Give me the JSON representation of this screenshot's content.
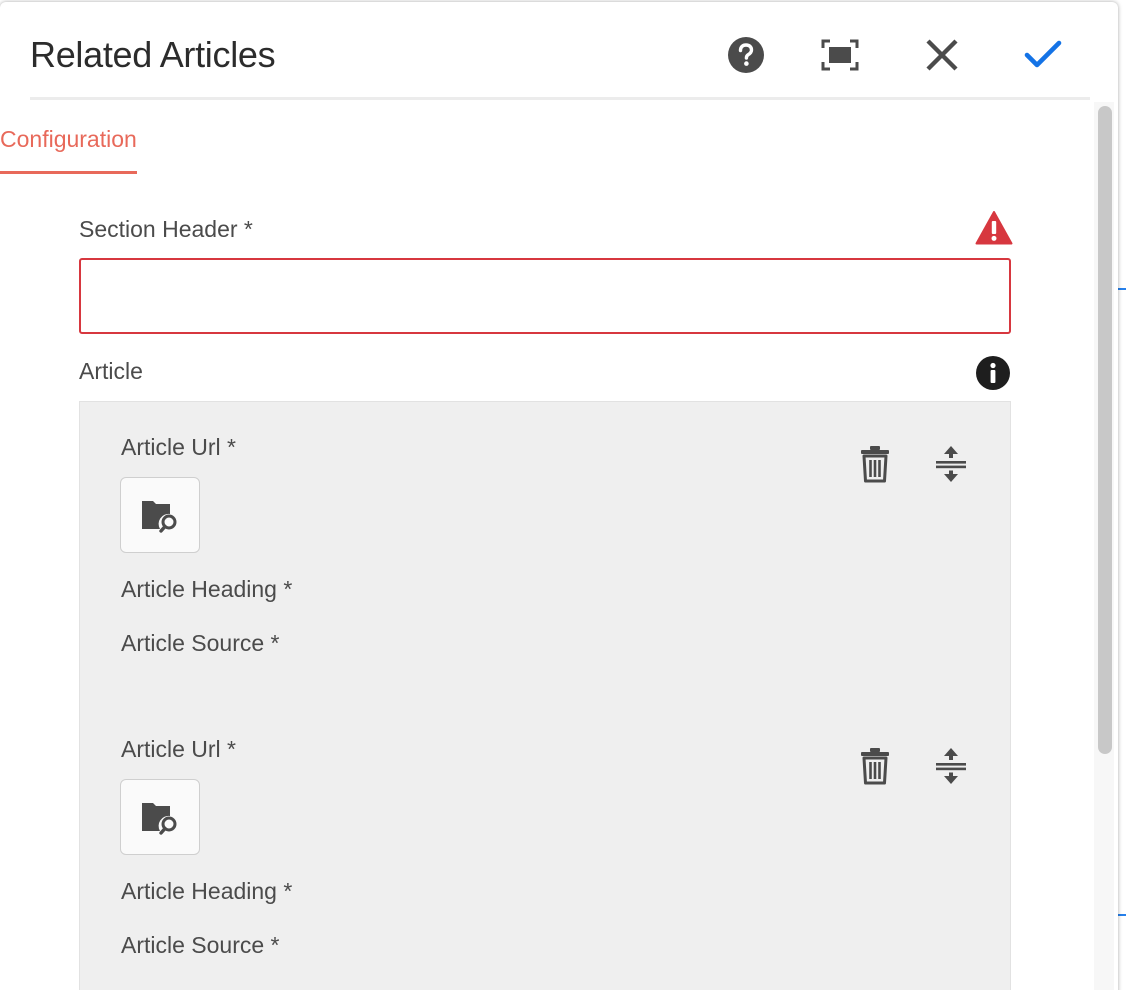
{
  "dialog": {
    "title": "Related Articles",
    "actions": {
      "help": "help-icon",
      "fullscreen": "fullscreen-icon",
      "close": "close-icon",
      "done": "checkmark-icon"
    }
  },
  "tabs": [
    {
      "label": "Configuration",
      "active": true
    }
  ],
  "form": {
    "section_header": {
      "label": "Section Header *",
      "value": "",
      "placeholder": "",
      "status": "error"
    },
    "article": {
      "label": "Article",
      "items": [
        {
          "url_label": "Article Url *",
          "heading_label": "Article Heading *",
          "source_label": "Article Source *"
        },
        {
          "url_label": "Article Url *",
          "heading_label": "Article Heading *",
          "source_label": "Article Source *"
        }
      ]
    }
  },
  "colors": {
    "accent_tab": "#e8695a",
    "error": "#d7373f",
    "primary": "#1473e6",
    "multifield_bg": "#efefef"
  }
}
